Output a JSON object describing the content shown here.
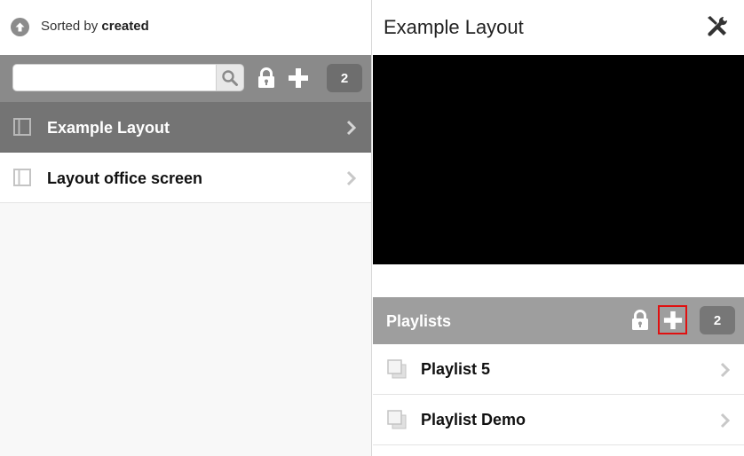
{
  "left_pane": {
    "sort": {
      "prefix": "Sorted by",
      "field": "created",
      "icon": "arrow-up-circle-icon"
    },
    "toolbar": {
      "search_value": "",
      "search_icon": "search-icon",
      "lock_icon": "lock-icon",
      "add_icon": "plus-icon",
      "count": "2"
    },
    "layouts": [
      {
        "label": "Example Layout",
        "selected": true,
        "icon": "layout-icon"
      },
      {
        "label": "Layout office screen",
        "selected": false,
        "icon": "layout-icon"
      }
    ]
  },
  "right_pane": {
    "title": "Example Layout",
    "tools_icon": "wrench-screwdriver-icon",
    "playlists": {
      "title": "Playlists",
      "count": "2",
      "lock_icon": "lock-icon",
      "add_icon": "plus-icon",
      "items": [
        {
          "label": "Playlist 5",
          "icon": "playlist-icon"
        },
        {
          "label": "Playlist Demo",
          "icon": "playlist-icon"
        }
      ]
    }
  },
  "colors": {
    "toolbar_bg": "#8a8a8a",
    "selected_row_bg": "#747474",
    "playlist_header_bg": "#9e9e9e",
    "badge_bg": "#6e6e6e",
    "preview_bg": "#000000",
    "highlight_border": "#e01010"
  }
}
